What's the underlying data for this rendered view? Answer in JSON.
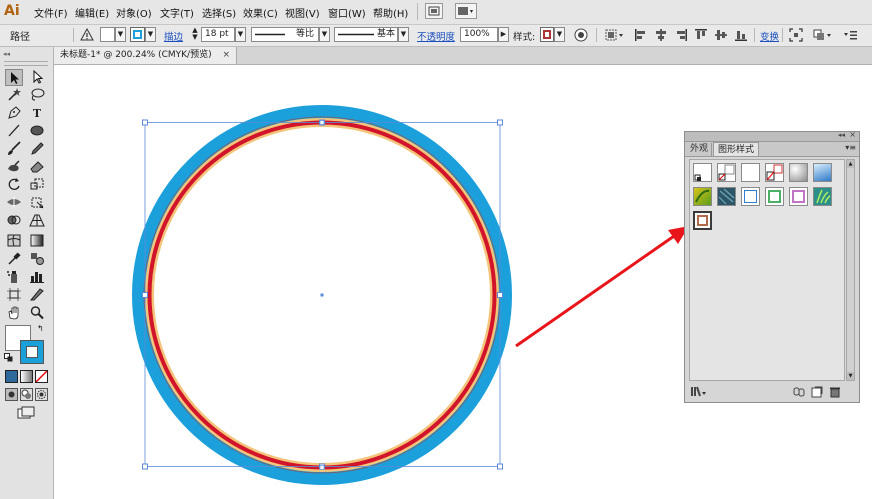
{
  "app": {
    "logo": "Ai"
  },
  "menu": [
    "文件(F)",
    "编辑(E)",
    "对象(O)",
    "文字(T)",
    "选择(S)",
    "效果(C)",
    "视图(V)",
    "窗口(W)",
    "帮助(H)"
  ],
  "control_bar": {
    "selection_label": "路径",
    "stroke_link": "描边",
    "stroke_weight": "18 pt",
    "profile_label": "等比",
    "brush_label": "基本",
    "opacity_link": "不透明度",
    "opacity_value": "100%",
    "style_label": "样式:",
    "transform_link": "变换"
  },
  "document": {
    "tab_title": "未标题-1* @ 200.24% (CMYK/预览)",
    "close": "×"
  },
  "panel": {
    "tabs": [
      "外观",
      "图形样式"
    ],
    "active_tab": "图形样式",
    "collapse_glyph": "◂◂",
    "close_glyph": "×",
    "menu_glyph": "▾≡"
  },
  "colors": {
    "outer_ring": "#1ba0db",
    "gold_ring": "#f3c47a",
    "red_ring": "#d2142a",
    "selection": "#5b8bd8",
    "arrow": "#e8161b"
  }
}
